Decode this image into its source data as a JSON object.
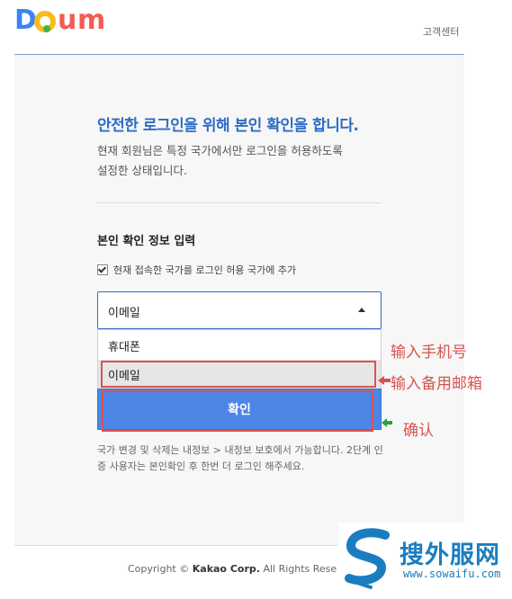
{
  "header": {
    "logo_text": "Daum",
    "help_link": "고객센터"
  },
  "main": {
    "title": "안전한 로그인을 위해 본인 확인을 합니다.",
    "description_line1": "현재 회원님은 특정 국가에서만 로그인을 허용하도록",
    "description_line2": "설정한 상태입니다.",
    "section_title": "본인 확인 정보 입력",
    "checkbox_label": "현재 접속한 국가를 로그인 허용 국가에 추가",
    "checkbox_checked": true,
    "select": {
      "selected": "이메일",
      "options": [
        "휴대폰",
        "이메일"
      ]
    },
    "confirm_button": "확인",
    "note": "국가 변경 및 삭제는 내정보 > 내정보 보호에서 가능합니다. 2단계 인증 사용자는 본인확인 후 한번 더 로그인 해주세요."
  },
  "footer": {
    "copyright_prefix": "Copyright ©",
    "company": "Kakao Corp.",
    "rights": "All Rights Reserv"
  },
  "annotations": {
    "phone": "输入手机号",
    "email": "输入备用邮箱",
    "confirm": "确认"
  },
  "watermark": {
    "name": "搜外服网",
    "url": "www.sowaifu.com"
  },
  "colors": {
    "accent": "#2c6cc4",
    "button": "#4d86e7",
    "annotation_red": "#d9534f",
    "annotation_green": "#2e9e3e",
    "watermark_blue": "#1a7dbf"
  }
}
